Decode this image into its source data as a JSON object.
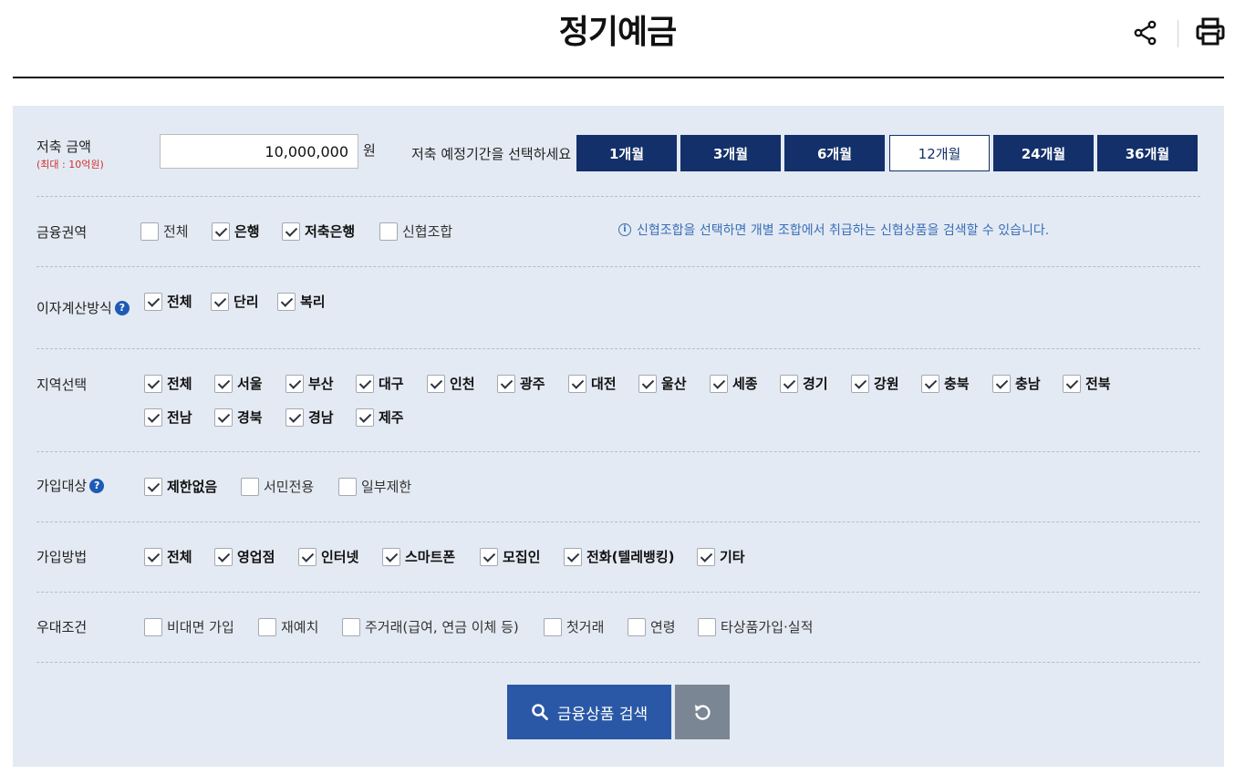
{
  "page": {
    "title": "정기예금"
  },
  "header": {
    "share_icon": "share-icon",
    "print_icon": "printer-icon"
  },
  "savings": {
    "amount_label": "저축 금액",
    "amount_limit": "(최대 : 10억원)",
    "amount_value": "10,000,000",
    "amount_unit": "원",
    "period_label": "저축 예정기간을 선택하세요",
    "periods": [
      "1개월",
      "3개월",
      "6개월",
      "12개월",
      "24개월",
      "36개월"
    ],
    "selected_period": "12개월"
  },
  "finance_sector": {
    "label": "금융권역",
    "options": [
      {
        "label": "전체",
        "checked": false
      },
      {
        "label": "은행",
        "checked": true
      },
      {
        "label": "저축은행",
        "checked": true
      },
      {
        "label": "신협조합",
        "checked": false
      }
    ],
    "notice": "신협조합을 선택하면 개별 조합에서 취급하는 신협상품을 검색할 수 있습니다."
  },
  "interest_method": {
    "label": "이자계산방식",
    "options": [
      {
        "label": "전체",
        "checked": true
      },
      {
        "label": "단리",
        "checked": true
      },
      {
        "label": "복리",
        "checked": true
      }
    ]
  },
  "region": {
    "label": "지역선택",
    "options": [
      {
        "label": "전체",
        "checked": true
      },
      {
        "label": "서울",
        "checked": true
      },
      {
        "label": "부산",
        "checked": true
      },
      {
        "label": "대구",
        "checked": true
      },
      {
        "label": "인천",
        "checked": true
      },
      {
        "label": "광주",
        "checked": true
      },
      {
        "label": "대전",
        "checked": true
      },
      {
        "label": "울산",
        "checked": true
      },
      {
        "label": "세종",
        "checked": true
      },
      {
        "label": "경기",
        "checked": true
      },
      {
        "label": "강원",
        "checked": true
      },
      {
        "label": "충북",
        "checked": true
      },
      {
        "label": "충남",
        "checked": true
      },
      {
        "label": "전북",
        "checked": true
      },
      {
        "label": "전남",
        "checked": true
      },
      {
        "label": "경북",
        "checked": true
      },
      {
        "label": "경남",
        "checked": true
      },
      {
        "label": "제주",
        "checked": true
      }
    ]
  },
  "join_target": {
    "label": "가입대상",
    "options": [
      {
        "label": "제한없음",
        "checked": true
      },
      {
        "label": "서민전용",
        "checked": false
      },
      {
        "label": "일부제한",
        "checked": false
      }
    ]
  },
  "join_method": {
    "label": "가입방법",
    "options": [
      {
        "label": "전체",
        "checked": true
      },
      {
        "label": "영업점",
        "checked": true
      },
      {
        "label": "인터넷",
        "checked": true
      },
      {
        "label": "스마트폰",
        "checked": true
      },
      {
        "label": "모집인",
        "checked": true
      },
      {
        "label": "전화(텔레뱅킹)",
        "checked": true
      },
      {
        "label": "기타",
        "checked": true
      }
    ]
  },
  "preferential": {
    "label": "우대조건",
    "options": [
      {
        "label": "비대면 가입",
        "checked": false
      },
      {
        "label": "재예치",
        "checked": false
      },
      {
        "label": "주거래(급여, 연금 이체 등)",
        "checked": false
      },
      {
        "label": "첫거래",
        "checked": false
      },
      {
        "label": "연령",
        "checked": false
      },
      {
        "label": "타상품가입·실적",
        "checked": false
      }
    ]
  },
  "actions": {
    "search_label": "금융상품 검색",
    "search_icon": "search-icon",
    "reset_icon": "reset-icon"
  }
}
